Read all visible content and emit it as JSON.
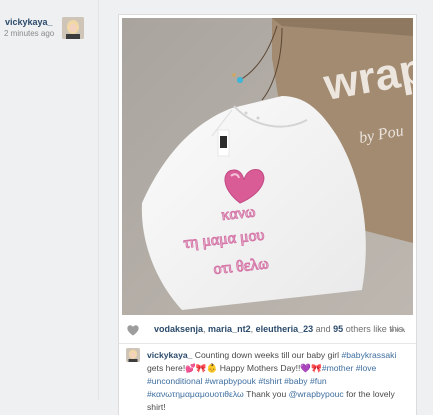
{
  "post": {
    "author": "vickykaya_",
    "time_ago": "2 minutes ago",
    "photo_text": {
      "brand": "wrap",
      "tagline": "by Pou",
      "shirt_line1": "κανω",
      "shirt_line2": "τη μαμα μου",
      "shirt_line3": "οτι θελω"
    },
    "likes": {
      "user1": "vodaksenja",
      "user2": "maria_nt2",
      "user3": "eleutheria_23",
      "sep1": ", ",
      "sep2": ", ",
      "and": " and ",
      "others_count": "95",
      "others_suffix": " others like this."
    },
    "more_label": "•••",
    "caption": {
      "user": "vickykaya_",
      "t1": "Counting down weeks till our baby girl ",
      "h1": "#babykrassaki",
      "t2": " gets here!💕🎀👶 Happy Mothers Day!!💜🎀",
      "h2": "#mother",
      "h3": "#love",
      "h4": "#unconditional",
      "h5": "#wrapbypouk",
      "h6": "#tshirt",
      "h7": "#baby",
      "h8": "#fun",
      "h9": "#κανωτημαμαμουοτιθελω",
      "t3": " Thank you ",
      "h10": "@wrapbypouc",
      "t4": " for the lovely shirt!"
    },
    "colors": {
      "heart": "#d95c96",
      "embroidery": "#d577a8",
      "link": "#3f6fa0",
      "username": "#2c4b6c"
    },
    "icons": {
      "like": "heart-icon",
      "more": "ellipsis-icon"
    }
  }
}
